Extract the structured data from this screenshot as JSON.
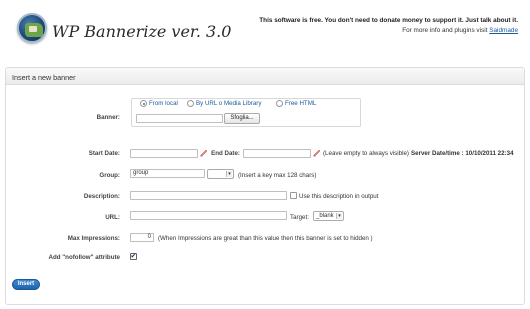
{
  "header": {
    "app_title": "WP Bannerize ver. 3.0",
    "tagline": "This software is free. You don't need to donate money to support it. Just talk about it.",
    "more_info_prefix": "For more info and plugins visit",
    "more_info_link": "Saidmade"
  },
  "panel": {
    "title": "Insert a new banner"
  },
  "banner": {
    "label": "Banner:",
    "options": [
      "From local",
      "By URL o Media Library",
      "Free HTML"
    ],
    "selected": "From local",
    "file_value": "",
    "browse_label": "Sfoglia..."
  },
  "dates": {
    "start_label": "Start Date:",
    "start_value": "",
    "end_label": "End Date:",
    "end_value": "",
    "hint": "(Leave empty to always visible)",
    "server_label": "Server Date/time : 10/10/2011 22:34"
  },
  "group": {
    "label": "Group:",
    "value": "group",
    "select_value": "",
    "hint": "(Insert a key max 128 chars)"
  },
  "description": {
    "label": "Description:",
    "value": "",
    "checkbox_label": "Use this description in output",
    "checked": false
  },
  "url": {
    "label": "URL:",
    "value": "",
    "target_label": "Target:",
    "target_value": "_blank"
  },
  "impressions": {
    "label": "Max Impressions:",
    "value": "0",
    "hint": "(When Impressions are great than this value then this banner is set to hidden )"
  },
  "nofollow": {
    "label": "Add \"nofollow\" attribute",
    "checked": true
  },
  "actions": {
    "insert_label": "Insert"
  },
  "colors": {
    "accent": "#2263a8",
    "link": "#1a5a9e"
  }
}
